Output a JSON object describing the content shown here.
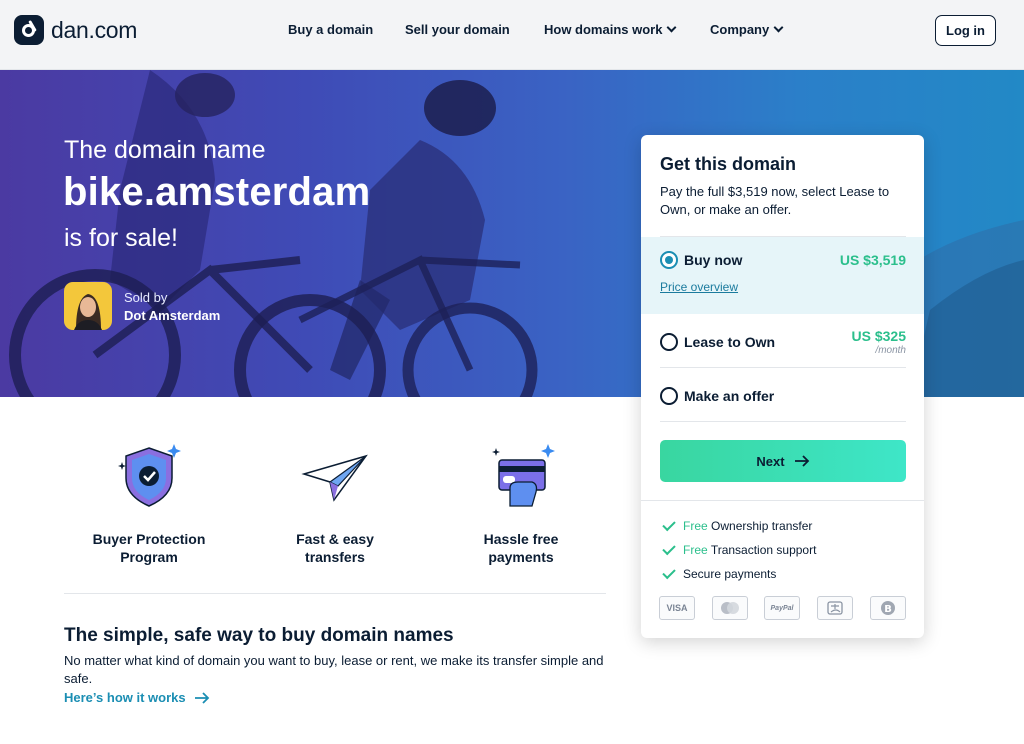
{
  "header": {
    "logo_text": "dan.com",
    "nav": [
      {
        "label": "Buy a domain",
        "has_dropdown": false
      },
      {
        "label": "Sell your domain",
        "has_dropdown": false
      },
      {
        "label": "How domains work",
        "has_dropdown": true
      },
      {
        "label": "Company",
        "has_dropdown": true
      }
    ],
    "login_label": "Log in"
  },
  "hero": {
    "pre_title": "The domain name",
    "domain": "bike.amsterdam",
    "post_title": "is for sale!",
    "seller_label": "Sold by",
    "seller_name": "Dot Amsterdam"
  },
  "features": [
    {
      "label": "Buyer Protection\nProgram",
      "icon": "shield-check-icon"
    },
    {
      "label": "Fast & easy\ntransfers",
      "icon": "paper-plane-icon"
    },
    {
      "label": "Hassle free\npayments",
      "icon": "credit-card-hand-icon"
    }
  ],
  "info": {
    "title": "The simple, safe way to buy domain names",
    "text": "No matter what kind of domain you want to buy, lease or rent, we make its transfer simple and safe.",
    "link": "Here’s how it works"
  },
  "card": {
    "title": "Get this domain",
    "description": "Pay the full $3,519 now, select Lease to Own, or make an offer.",
    "options": {
      "buy": {
        "label": "Buy now",
        "price": "US $3,519",
        "link": "Price overview",
        "selected": true
      },
      "lease": {
        "label": "Lease to Own",
        "price": "US $325",
        "per": "/month",
        "selected": false
      },
      "offer": {
        "label": "Make an offer",
        "selected": false
      }
    },
    "next_label": "Next",
    "perks": [
      {
        "free": "Free",
        "text": "Ownership transfer"
      },
      {
        "free": "Free",
        "text": "Transaction support"
      },
      {
        "free": "",
        "text": "Secure payments"
      }
    ],
    "payment_methods": [
      "VISA",
      "mastercard",
      "PayPal",
      "alipay",
      "bitcoin"
    ]
  },
  "colors": {
    "navy": "#0b1d33",
    "accent_green": "#2bbf8c",
    "accent_teal": "#1b8eb3",
    "hero_left": "#4b3aa2",
    "hero_right": "#2289c6"
  }
}
